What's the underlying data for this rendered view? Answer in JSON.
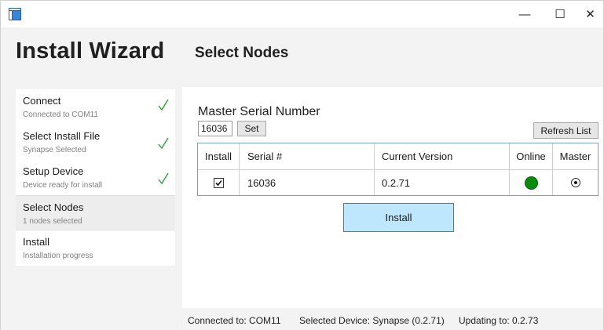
{
  "window": {
    "app_icon": "app-grid-icon",
    "minimize_glyph": "—",
    "maximize_glyph": "☐",
    "close_glyph": "✕"
  },
  "sidebar": {
    "title": "Install Wizard",
    "steps": [
      {
        "title": "Connect",
        "subtitle": "Connected to COM11",
        "completed": true
      },
      {
        "title": "Select Install File",
        "subtitle": "Synapse Selected",
        "completed": true
      },
      {
        "title": "Setup Device",
        "subtitle": "Device ready for install",
        "completed": true
      },
      {
        "title": "Select Nodes",
        "subtitle": "1 nodes selected",
        "completed": false,
        "active": true
      },
      {
        "title": "Install",
        "subtitle": "Installation progress",
        "completed": false
      }
    ]
  },
  "main": {
    "title": "Select Nodes",
    "master_serial_label": "Master Serial Number",
    "master_serial_value": "16036",
    "set_label": "Set",
    "refresh_label": "Refresh List",
    "table": {
      "columns": [
        "Install",
        "Serial #",
        "Current Version",
        "Online",
        "Master"
      ],
      "rows": [
        {
          "install": true,
          "serial": "16036",
          "version": "0.2.71",
          "online": true,
          "master": true
        }
      ]
    },
    "install_label": "Install"
  },
  "status": {
    "connected": "Connected to: COM11",
    "selected_device": "Selected Device: Synapse (0.2.71)",
    "updating_to": "Updating to: 0.2.73"
  },
  "colors": {
    "check": "#2e9e3e",
    "online": "#0c8a0c",
    "install_button": "#bee6fd",
    "table_border": "#7a9ed1",
    "app_icon": "#1f5fa8"
  }
}
